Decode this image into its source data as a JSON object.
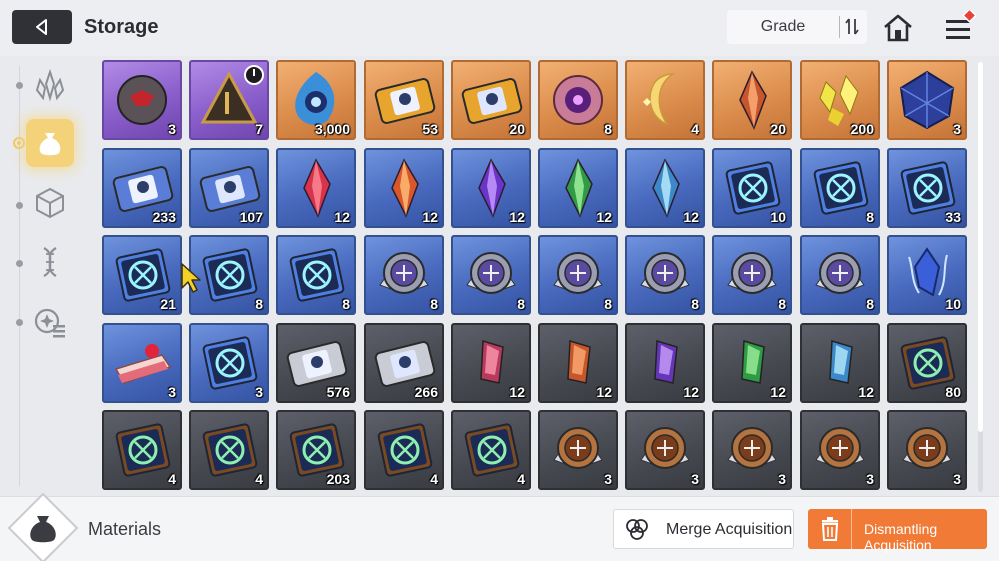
{
  "header": {
    "title": "Storage",
    "sort_label": "Grade"
  },
  "sidebar": {
    "items": [
      {
        "icon": "crystal-cluster-icon",
        "active": false
      },
      {
        "icon": "material-bag-icon",
        "active": true
      },
      {
        "icon": "cube-icon",
        "active": false
      },
      {
        "icon": "dna-helix-icon",
        "active": false
      },
      {
        "icon": "gear-list-icon",
        "active": false
      }
    ]
  },
  "grid": {
    "rows": [
      [
        {
          "rarity": "purple",
          "icon": "dark-core-icon",
          "qty": "3"
        },
        {
          "rarity": "purple",
          "icon": "pyramid-fragment-icon",
          "qty": "7",
          "timer": true
        },
        {
          "rarity": "orange",
          "icon": "blue-flame-orb-icon",
          "qty": "3,000"
        },
        {
          "rarity": "orange",
          "icon": "gold-character-ticket-icon",
          "qty": "53"
        },
        {
          "rarity": "orange",
          "icon": "gold-compass-ticket-icon",
          "qty": "20"
        },
        {
          "rarity": "orange",
          "icon": "purple-eye-core-icon",
          "qty": "8"
        },
        {
          "rarity": "orange",
          "icon": "gold-crescent-icon",
          "qty": "4"
        },
        {
          "rarity": "orange",
          "icon": "orange-crystal-icon",
          "qty": "20"
        },
        {
          "rarity": "orange",
          "icon": "yellow-shards-icon",
          "qty": "200"
        },
        {
          "rarity": "orange",
          "icon": "blue-cube-gem-icon",
          "qty": "3"
        }
      ],
      [
        {
          "rarity": "blue",
          "icon": "blue-character-ticket-icon",
          "qty": "233"
        },
        {
          "rarity": "blue",
          "icon": "blue-compass-ticket-icon",
          "qty": "107"
        },
        {
          "rarity": "blue",
          "icon": "red-crystal-icon",
          "qty": "12"
        },
        {
          "rarity": "blue",
          "icon": "amber-crystal-icon",
          "qty": "12"
        },
        {
          "rarity": "blue",
          "icon": "violet-crystal-icon",
          "qty": "12"
        },
        {
          "rarity": "blue",
          "icon": "green-crystal-icon",
          "qty": "12"
        },
        {
          "rarity": "blue",
          "icon": "cyan-crystal-icon",
          "qty": "12"
        },
        {
          "rarity": "blue",
          "icon": "sword-book-icon",
          "qty": "10"
        },
        {
          "rarity": "blue",
          "icon": "shield-book-icon",
          "qty": "8"
        },
        {
          "rarity": "blue",
          "icon": "target-book-icon",
          "qty": "33"
        }
      ],
      [
        {
          "rarity": "blue",
          "icon": "wing-book-icon",
          "qty": "21"
        },
        {
          "rarity": "blue",
          "icon": "bolt-book-icon",
          "qty": "8"
        },
        {
          "rarity": "blue",
          "icon": "rune-book-icon",
          "qty": "8"
        },
        {
          "rarity": "blue",
          "icon": "sword-medal-icon",
          "qty": "8"
        },
        {
          "rarity": "blue",
          "icon": "shield-medal-icon",
          "qty": "8"
        },
        {
          "rarity": "blue",
          "icon": "target-medal-icon",
          "qty": "8"
        },
        {
          "rarity": "blue",
          "icon": "wing-medal-icon",
          "qty": "8"
        },
        {
          "rarity": "blue",
          "icon": "bolt-medal-icon",
          "qty": "8"
        },
        {
          "rarity": "blue",
          "icon": "rune-medal-icon",
          "qty": "8"
        },
        {
          "rarity": "blue",
          "icon": "blue-flame-crystal-icon",
          "qty": "10"
        }
      ],
      [
        {
          "rarity": "blue",
          "icon": "strawberry-cake-icon",
          "qty": "3"
        },
        {
          "rarity": "blue",
          "icon": "blue-emblem-book-icon",
          "qty": "3"
        },
        {
          "rarity": "gray",
          "icon": "silver-character-ticket-icon",
          "qty": "576"
        },
        {
          "rarity": "gray",
          "icon": "silver-compass-ticket-icon",
          "qty": "266"
        },
        {
          "rarity": "gray",
          "icon": "pink-shard-icon",
          "qty": "12"
        },
        {
          "rarity": "gray",
          "icon": "orange-shard-icon",
          "qty": "12"
        },
        {
          "rarity": "gray",
          "icon": "purple-shard-icon",
          "qty": "12"
        },
        {
          "rarity": "gray",
          "icon": "green-shard-icon",
          "qty": "12"
        },
        {
          "rarity": "gray",
          "icon": "cyan-shard-icon",
          "qty": "12"
        },
        {
          "rarity": "gray",
          "icon": "bronze-sword-book-icon",
          "qty": "80"
        }
      ],
      [
        {
          "rarity": "gray",
          "icon": "bronze-shield-book-icon",
          "qty": "4"
        },
        {
          "rarity": "gray",
          "icon": "bronze-target-book-icon",
          "qty": "4"
        },
        {
          "rarity": "gray",
          "icon": "bronze-wing-book-icon",
          "qty": "203"
        },
        {
          "rarity": "gray",
          "icon": "bronze-bolt-book-icon",
          "qty": "4"
        },
        {
          "rarity": "gray",
          "icon": "bronze-rune-book-icon",
          "qty": "4"
        },
        {
          "rarity": "gray",
          "icon": "bronze-sword-medal-icon",
          "qty": "3"
        },
        {
          "rarity": "gray",
          "icon": "bronze-shield-medal-icon",
          "qty": "3"
        },
        {
          "rarity": "gray",
          "icon": "bronze-target-medal-icon",
          "qty": "3"
        },
        {
          "rarity": "gray",
          "icon": "bronze-wing-medal-icon",
          "qty": "3"
        },
        {
          "rarity": "gray",
          "icon": "bronze-bolt-medal-icon",
          "qty": "3"
        }
      ]
    ]
  },
  "footer": {
    "category_label": "Materials",
    "merge_label": "Merge Acquisition",
    "dismantle_label": "Dismantling Acquisition"
  },
  "colors": {
    "accent": "#f07a36",
    "active_tab": "#f3d27a",
    "purple_tier": "#8a5ecb",
    "orange_tier": "#db8d4c",
    "blue_tier": "#4869bd",
    "gray_tier": "#45484f"
  }
}
